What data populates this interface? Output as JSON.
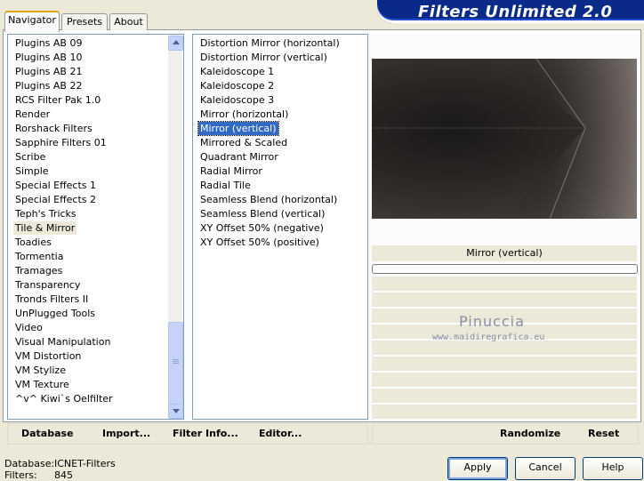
{
  "app_title": "Filters Unlimited 2.0",
  "tabs": [
    "Navigator",
    "Presets",
    "About"
  ],
  "categories": [
    "Plugins AB 09",
    "Plugins AB 10",
    "Plugins AB 21",
    "Plugins AB 22",
    "RCS Filter Pak 1.0",
    "Render",
    "Rorshack Filters",
    "Sapphire Filters 01",
    "Scribe",
    "Simple",
    "Special Effects 1",
    "Special Effects 2",
    "Teph's Tricks",
    "Tile & Mirror",
    "Toadies",
    "Tormentia",
    "Tramages",
    "Transparency",
    "Tronds Filters II",
    "UnPlugged Tools",
    "Video",
    "Visual Manipulation",
    "VM Distortion",
    "VM Stylize",
    "VM Texture",
    "^v^ Kiwi`s Oelfilter"
  ],
  "selected_category": "Tile & Mirror",
  "filters": [
    "Distortion Mirror (horizontal)",
    "Distortion Mirror (vertical)",
    "Kaleidoscope 1",
    "Kaleidoscope 2",
    "Kaleidoscope 3",
    "Mirror (horizontal)",
    "Mirror (vertical)",
    "Mirrored & Scaled",
    "Quadrant Mirror",
    "Radial Mirror",
    "Radial Tile",
    "Seamless Blend (horizontal)",
    "Seamless Blend (vertical)",
    "XY Offset 50% (negative)",
    "XY Offset 50% (positive)"
  ],
  "selected_filter": "Mirror (vertical)",
  "current_filter_name": "Mirror (vertical)",
  "watermark": {
    "name": "Pinuccia",
    "url": "www.maidiregrafica.eu"
  },
  "left_toolbar": {
    "database": "Database",
    "import": "Import...",
    "filter_info": "Filter Info...",
    "editor": "Editor..."
  },
  "right_toolbar": {
    "randomize": "Randomize",
    "reset": "Reset"
  },
  "status": {
    "database_label": "Database:",
    "database_value": "ICNET-Filters",
    "filters_label": "Filters:",
    "filters_value": "845"
  },
  "buttons": {
    "apply": "Apply",
    "cancel": "Cancel",
    "help": "Help"
  },
  "colors": {
    "title_bar": "#0a2a8a",
    "selection": "#316ac5",
    "panel": "#ece9d8"
  }
}
